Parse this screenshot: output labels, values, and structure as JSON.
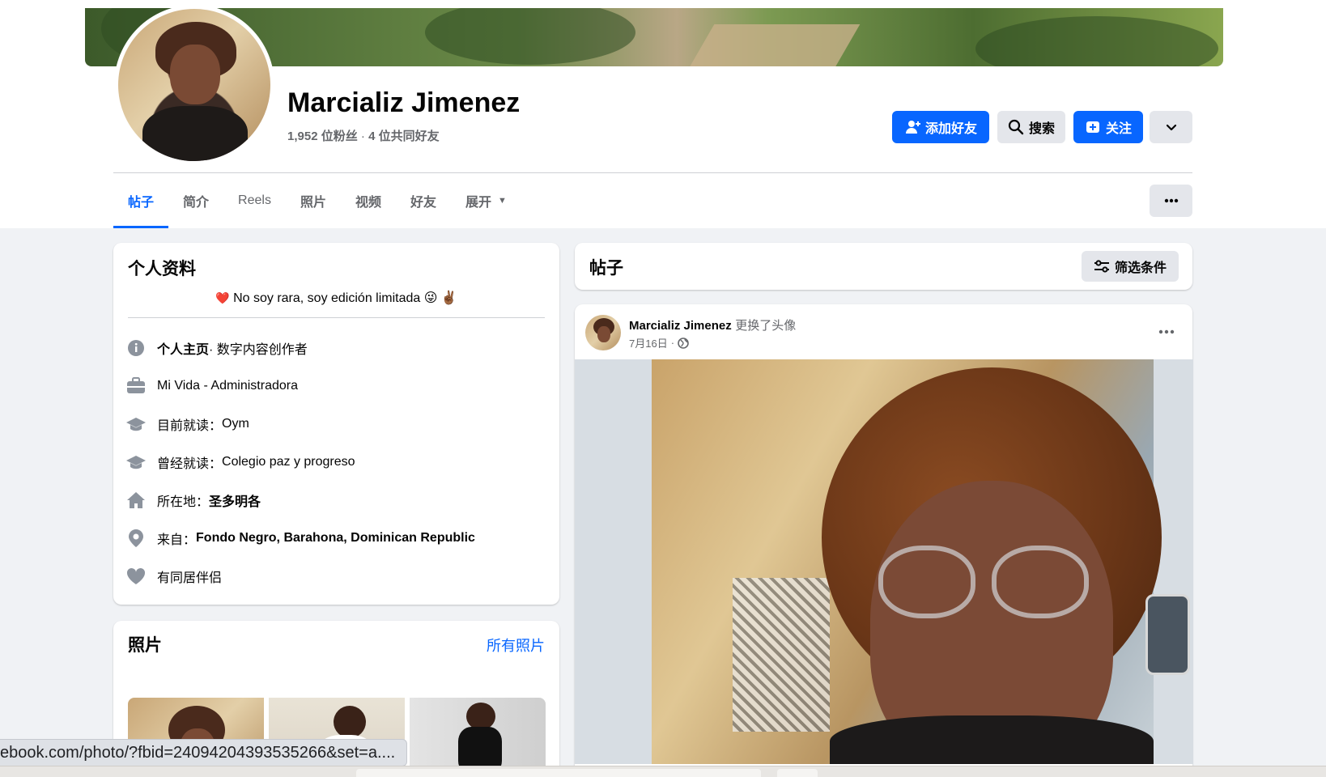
{
  "profile": {
    "name": "Marcializ Jimenez",
    "followers": "1,952",
    "followers_label": "位粉丝",
    "separator": "·",
    "mutual_count": "4",
    "mutual_label": "位共同好友"
  },
  "actions": {
    "add_friend": "添加好友",
    "search": "搜索",
    "follow": "关注"
  },
  "tabs": [
    {
      "label": "帖子",
      "active": true
    },
    {
      "label": "简介"
    },
    {
      "label": "Reels"
    },
    {
      "label": "照片"
    },
    {
      "label": "视频"
    },
    {
      "label": "好友"
    },
    {
      "label": "展开"
    }
  ],
  "intro": {
    "title": "个人资料",
    "bio": "No soy rara, soy edición limitada",
    "bio_heart": "❤️",
    "bio_emoji_1": "😜",
    "bio_emoji_2": "✌🏾",
    "items": [
      {
        "icon": "info-icon",
        "strong": "个人主页",
        "text": " · 数字内容创作者"
      },
      {
        "icon": "briefcase-icon",
        "text": "Mi Vida - Administradora"
      },
      {
        "icon": "graduation-cap-icon",
        "prefix": "目前就读：",
        "text": "Oym"
      },
      {
        "icon": "graduation-cap-icon",
        "prefix": "曾经就读：",
        "text": "Colegio paz y progreso"
      },
      {
        "icon": "home-icon",
        "prefix": "所在地：",
        "strong": "圣多明各"
      },
      {
        "icon": "location-pin-icon",
        "prefix": "来自：",
        "strong": "Fondo Negro, Barahona, Dominican Republic"
      },
      {
        "icon": "heart-icon",
        "text": "有同居伴侣"
      }
    ]
  },
  "photos": {
    "title": "照片",
    "link": "所有照片"
  },
  "posts": {
    "title": "帖子",
    "filter": "筛选条件",
    "post": {
      "author": "Marcializ Jimenez",
      "action": "更换了头像",
      "date": "7月16日",
      "dot": "·"
    }
  },
  "status_bar": {
    "url": "ebook.com/photo/?fbid=24094204393535266&set=a...."
  },
  "colors": {
    "accent": "#0866ff",
    "page_bg": "#f0f2f5",
    "secondary_text": "#65676b"
  }
}
